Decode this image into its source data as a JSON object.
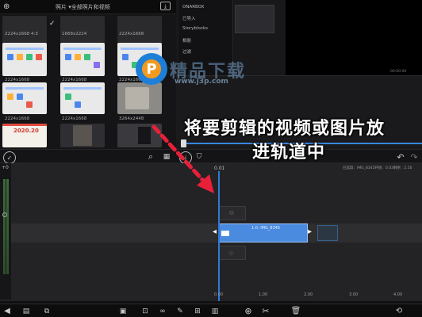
{
  "photos": {
    "title": "照片 ▾全部照片和视频",
    "size_labels": [
      "2224x1668 4:3",
      "1668x2224",
      "2224x1668",
      "2224x1668",
      "2224x1668",
      "2224x1668",
      "2224x1668",
      "2224x1668",
      "3264x2448"
    ],
    "bottom_tile_text": "2020.20"
  },
  "library": {
    "items": [
      "ONARBOX",
      "已导入",
      "Storyblocks",
      "相册",
      "过滤"
    ],
    "timecode": "00:00:00"
  },
  "watermark": {
    "logo_text": "P",
    "site_name": "精品下载",
    "url": "www.j3p.com"
  },
  "caption": {
    "line1": "将要剪辑的视频或图片放",
    "line2": "进轨道中"
  },
  "timeline": {
    "start_label": "0.01",
    "project_info": "已选取：IMG_8345开始：0.03剩余：2.50",
    "clip_label": "1.0: IMG_8345",
    "left_scale_top": "+0",
    "ruler_ticks": [
      "0.00",
      "1.00",
      "2.00",
      "3.00",
      "4.00"
    ]
  },
  "colors": {
    "accent": "#2f7ad6",
    "clip": "#4a8be0",
    "arrow": "#e8203a",
    "watermark_blue": "#1e7fd8",
    "watermark_orange": "#f39a1e"
  }
}
